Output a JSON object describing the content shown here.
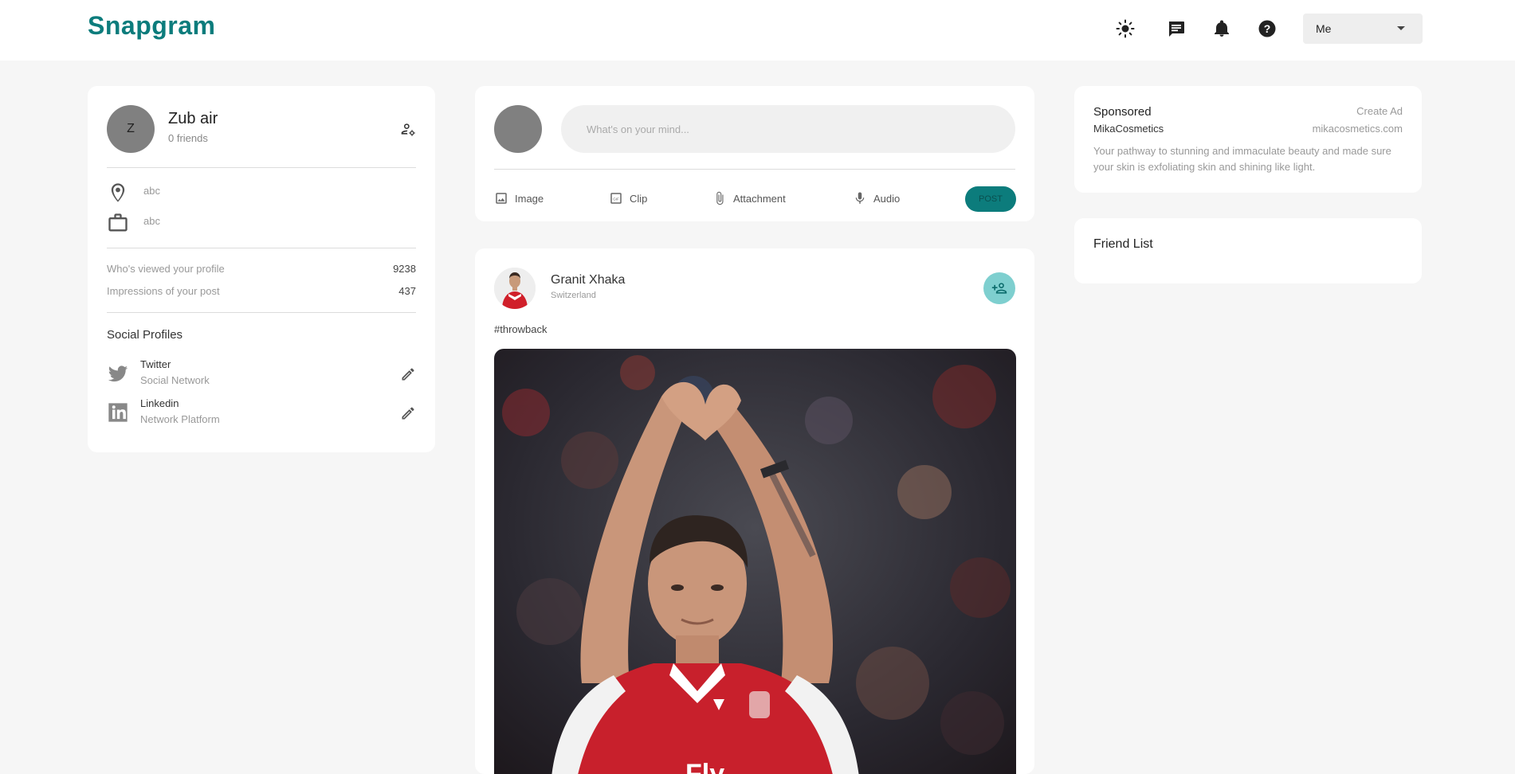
{
  "app": {
    "brand": "Snapgram",
    "user_menu": {
      "selected": "Me"
    },
    "nav_icons": [
      "light-mode-icon",
      "message-icon",
      "notification-icon",
      "help-icon"
    ],
    "accent_color": "#0c7c7c"
  },
  "profile": {
    "avatar_initial": "Z",
    "name": "Zub air",
    "friends": "0 friends",
    "location": "abc",
    "occupation": "abc",
    "stats": [
      {
        "label": "Who's viewed your profile",
        "value": "9238"
      },
      {
        "label": "Impressions of your post",
        "value": "437"
      }
    ],
    "social_title": "Social Profiles",
    "social": [
      {
        "name": "Twitter",
        "sub": "Social Network",
        "icon": "twitter-icon"
      },
      {
        "name": "Linkedin",
        "sub": "Network Platform",
        "icon": "linkedin-icon"
      }
    ]
  },
  "composer": {
    "placeholder": "What's on your mind...",
    "actions": [
      {
        "label": "Image",
        "icon": "image-icon"
      },
      {
        "label": "Clip",
        "icon": "gif-icon"
      },
      {
        "label": "Attachment",
        "icon": "attachment-icon"
      },
      {
        "label": "Audio",
        "icon": "microphone-icon"
      }
    ],
    "post_label": "POST"
  },
  "feed": {
    "post": {
      "author": "Granit Xhaka",
      "location": "Switzerland",
      "text": "#throwback"
    }
  },
  "sponsored": {
    "title": "Sponsored",
    "create_ad": "Create Ad",
    "brand": "MikaCosmetics",
    "url": "mikacosmetics.com",
    "description": "Your pathway to stunning and immaculate beauty and made sure your skin is exfoliating skin and shining like light."
  },
  "friend_list": {
    "title": "Friend List"
  }
}
